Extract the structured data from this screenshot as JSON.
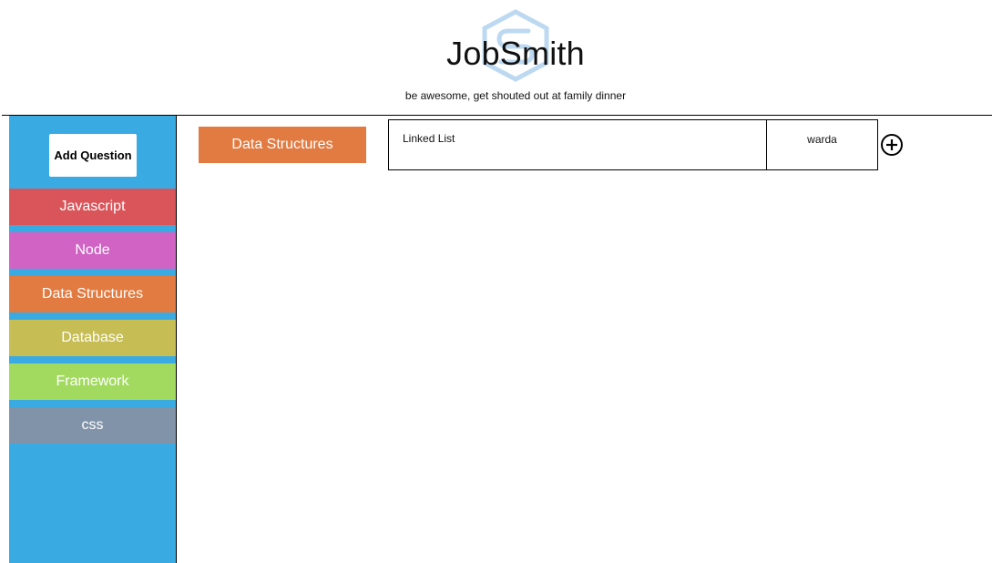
{
  "header": {
    "title": "JobSmith",
    "tagline": "be awesome, get shouted out at family dinner",
    "logo_icon": "hexagon-s-logo-icon",
    "logo_color": "#bcd9f1"
  },
  "sidebar": {
    "background": "#3aaae2",
    "add_question_label": "Add Question",
    "categories": [
      {
        "label": "Javascript",
        "color": "#d9555a"
      },
      {
        "label": "Node",
        "color": "#d063c3"
      },
      {
        "label": "Data Structures",
        "color": "#e27b41"
      },
      {
        "label": "Database",
        "color": "#c7bd55"
      },
      {
        "label": "Framework",
        "color": "#a2da5f"
      },
      {
        "label": "css",
        "color": "#8193a9"
      }
    ]
  },
  "main": {
    "active_topic": "Data Structures",
    "active_topic_color": "#e27b41",
    "questions": [
      {
        "question": "Linked List",
        "user": "warda"
      }
    ],
    "add_icon": "plus-circle-icon"
  }
}
